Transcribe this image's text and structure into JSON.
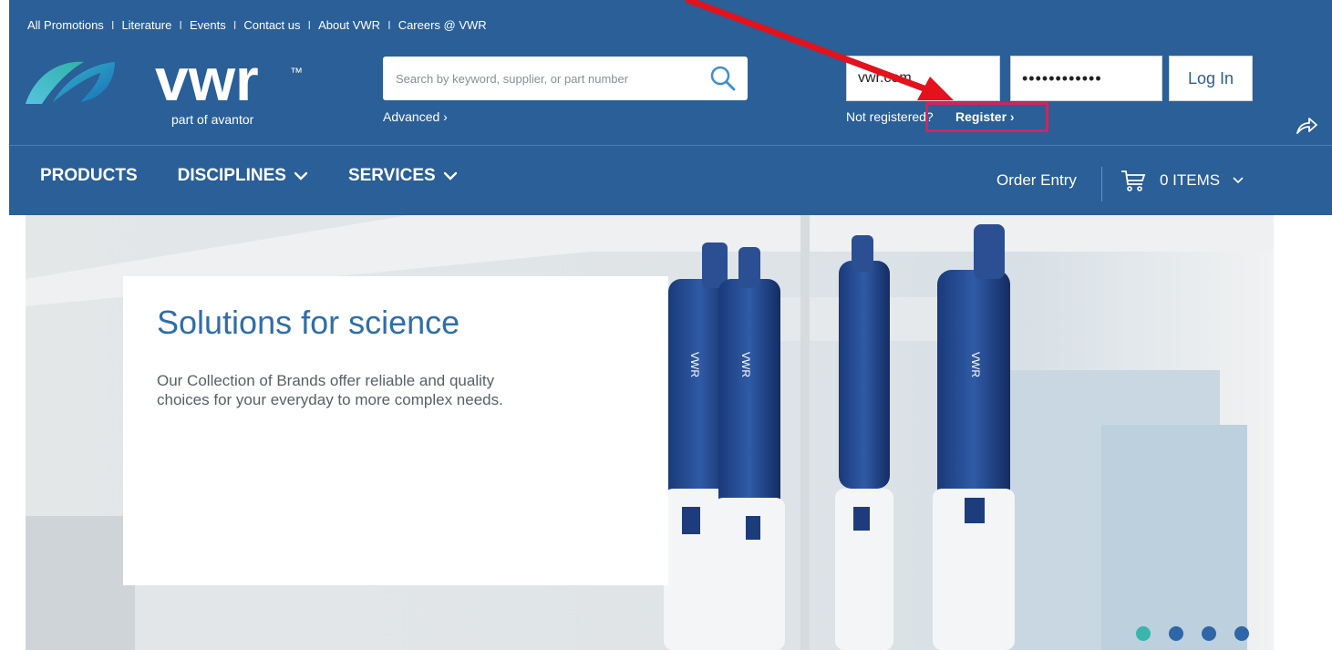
{
  "top_links": [
    "All Promotions",
    "Literature",
    "Events",
    "Contact us",
    "About VWR",
    "Careers @ VWR"
  ],
  "top_link_separator": "I",
  "logo": {
    "wordmark": "vwr",
    "trademark": "™",
    "tagline": "part of avantor"
  },
  "search": {
    "placeholder": "Search by keyword, supplier, or part number",
    "advanced_label": "Advanced ›"
  },
  "login": {
    "email_value": "vwr.com",
    "password_value": "••••••••••••",
    "login_label": "Log In",
    "not_registered_text": "Not registered?",
    "register_label": "Register ›"
  },
  "main_nav": [
    {
      "label": "PRODUCTS"
    },
    {
      "label": "DISCIPLINES"
    },
    {
      "label": "SERVICES"
    }
  ],
  "order_entry_label": "Order Entry",
  "cart": {
    "label": "0 ITEMS"
  },
  "hero": {
    "title": "Solutions for science",
    "text": "Our Collection of Brands offer reliable and quality choices for your everyday to more complex needs.",
    "pipette_brand": "VWR"
  },
  "carousel": {
    "slides": 4,
    "active_index": 0
  },
  "colors": {
    "header": "#2a5f97",
    "link_blue": "#2f6ea8",
    "highlight_box": "#d1245f",
    "arrow": "#e3121c",
    "dot_active": "#3ab5ad",
    "dot": "#2e66a8"
  },
  "icons": [
    "search-icon",
    "chevron-down-icon",
    "cart-icon",
    "share-icon",
    "annotation-arrow-icon"
  ]
}
